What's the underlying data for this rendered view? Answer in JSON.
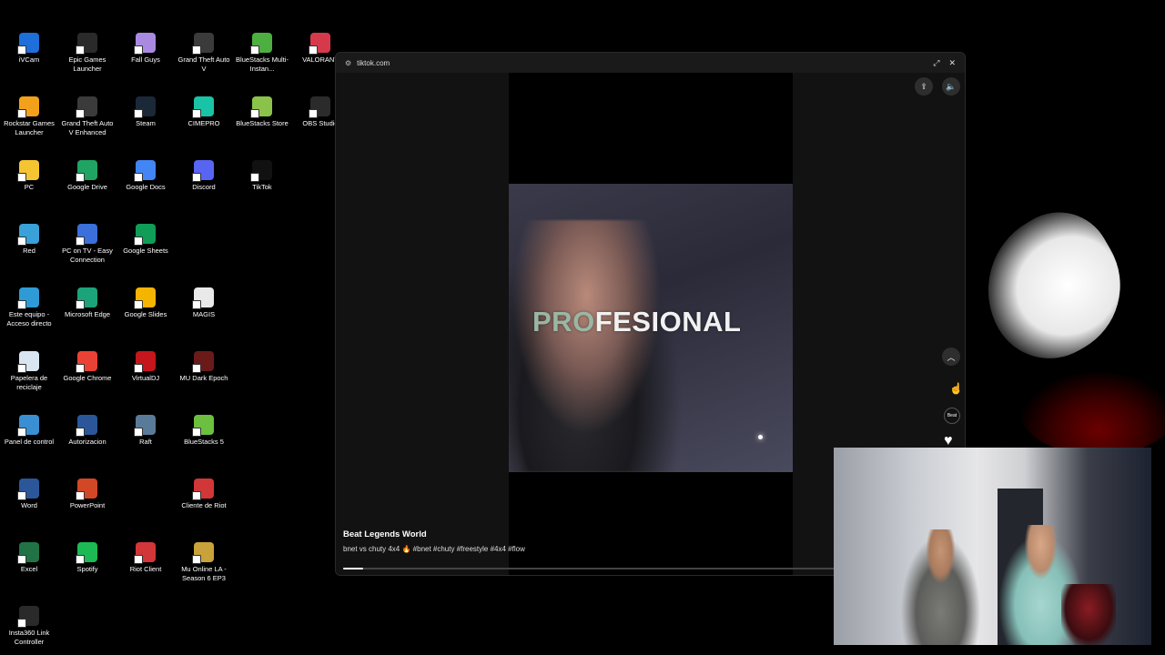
{
  "desktop": {
    "icons": [
      {
        "label": "iVCam",
        "color": "#1e6fd9"
      },
      {
        "label": "Epic Games Launcher",
        "color": "#2a2a2a"
      },
      {
        "label": "Fall Guys",
        "color": "#a98ae0"
      },
      {
        "label": "Grand Theft Auto V",
        "color": "#3b3b3b"
      },
      {
        "label": "BlueStacks Multi-Instan...",
        "color": "#4caf3f"
      },
      {
        "label": "VALORANT",
        "color": "#d63a4a"
      },
      {
        "label": "Rockstar Games Launcher",
        "color": "#f3a11a"
      },
      {
        "label": "Grand Theft Auto V Enhanced",
        "color": "#3b3b3b"
      },
      {
        "label": "Steam",
        "color": "#1b2838"
      },
      {
        "label": "CIMEPRO",
        "color": "#19c3a6"
      },
      {
        "label": "BlueStacks Store",
        "color": "#8bc34a"
      },
      {
        "label": "OBS Studio",
        "color": "#2b2b2b"
      },
      {
        "label": "PC",
        "color": "#f5c531"
      },
      {
        "label": "Google Drive",
        "color": "#1fa463"
      },
      {
        "label": "Google Docs",
        "color": "#4285f4"
      },
      {
        "label": "Discord",
        "color": "#5865f2"
      },
      {
        "label": "TikTok",
        "color": "#111111"
      },
      {
        "label": "Red",
        "color": "#3aa0d8"
      },
      {
        "label": "PC on TV - Easy Connection",
        "color": "#3b6fd9"
      },
      {
        "label": "Google Sheets",
        "color": "#0f9d58"
      },
      {
        "label": "Este equipo - Acceso directo",
        "color": "#2e9bd6"
      },
      {
        "label": "Microsoft Edge",
        "color": "#1ca37a"
      },
      {
        "label": "Google Slides",
        "color": "#f4b400"
      },
      {
        "label": "MAGIS",
        "color": "#e9e9e9"
      },
      {
        "label": "Papelera de reciclaje",
        "color": "#d9e6f2"
      },
      {
        "label": "Google Chrome",
        "color": "#e94235"
      },
      {
        "label": "VirtualDJ",
        "color": "#c4161c"
      },
      {
        "label": "MU Dark Epoch",
        "color": "#6b1a1a"
      },
      {
        "label": "Panel de control",
        "color": "#3a8fd3"
      },
      {
        "label": "Autorizacion",
        "color": "#2b579a"
      },
      {
        "label": "Raft",
        "color": "#5a7a9a"
      },
      {
        "label": "BlueStacks 5",
        "color": "#6cbf3f"
      },
      {
        "label": "Word",
        "color": "#2b579a"
      },
      {
        "label": "PowerPoint",
        "color": "#d24726"
      },
      {
        "label": "Cliente de Riot",
        "color": "#d13639"
      },
      {
        "label": "Excel",
        "color": "#217346"
      },
      {
        "label": "Spotify",
        "color": "#1db954"
      },
      {
        "label": "Riot Client",
        "color": "#d13639"
      },
      {
        "label": "Mu Online LA - Season 6 EP3",
        "color": "#c9a23a"
      },
      {
        "label": "Insta360 Link Controller",
        "color": "#2a2a2a"
      }
    ]
  },
  "window": {
    "url": "tiktok.com",
    "tune_icon": "⚙",
    "expand_icon": "⤢",
    "close_icon": "✕"
  },
  "player": {
    "overlay_text_prefix": "PRO",
    "overlay_text_rest": "FESIONAL",
    "upload_icon": "⇪",
    "volume_icon": "🔈",
    "prev_icon": "︿",
    "cursor_icon": "☝",
    "creator_avatar_text": "Beat",
    "like_icon": "♥",
    "author": "Beat Legends World",
    "description": "bnet vs chuty 4x4 🔥 #bnet #chuty #freestyle #4x4 #flow",
    "progress_fraction": 0.04
  }
}
